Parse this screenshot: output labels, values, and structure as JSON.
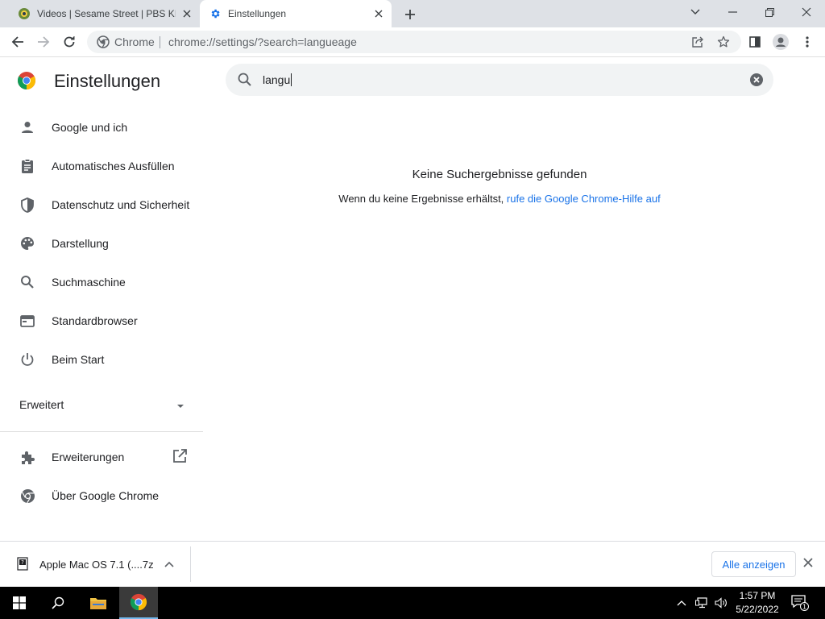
{
  "browser": {
    "tabs": [
      {
        "title": "Videos | Sesame Street | PBS KIDS",
        "active": false
      },
      {
        "title": "Einstellungen",
        "active": true
      }
    ],
    "omnibox": {
      "chip": "Chrome",
      "url": "chrome://settings/?search=langueage"
    }
  },
  "settings": {
    "title": "Einstellungen",
    "search": {
      "query": "langu"
    },
    "nav": [
      {
        "label": "Google und ich",
        "icon": "person-icon"
      },
      {
        "label": "Automatisches Ausfüllen",
        "icon": "clipboard-icon"
      },
      {
        "label": "Datenschutz und Sicherheit",
        "icon": "shield-icon"
      },
      {
        "label": "Darstellung",
        "icon": "palette-icon"
      },
      {
        "label": "Suchmaschine",
        "icon": "search-icon"
      },
      {
        "label": "Standardbrowser",
        "icon": "browser-window-icon"
      },
      {
        "label": "Beim Start",
        "icon": "power-icon"
      }
    ],
    "advanced": {
      "label": "Erweitert"
    },
    "extensions": {
      "label": "Erweiterungen"
    },
    "about": {
      "label": "Über Google Chrome"
    },
    "no_results": {
      "heading": "Keine Suchergebnisse gefunden",
      "text": "Wenn du keine Ergebnisse erhältst,",
      "link": "rufe die Google Chrome-Hilfe auf"
    }
  },
  "downloads": {
    "file": "Apple Mac OS 7.1 (....7z",
    "show_all": "Alle anzeigen"
  },
  "taskbar": {
    "time": "1:57 PM",
    "date": "5/22/2022",
    "notification_count": "1"
  },
  "colors": {
    "accent": "#1a73e8",
    "tab_strip": "#dee1e6",
    "omnibox_bg": "#f1f3f4",
    "taskbar": "#000000"
  }
}
